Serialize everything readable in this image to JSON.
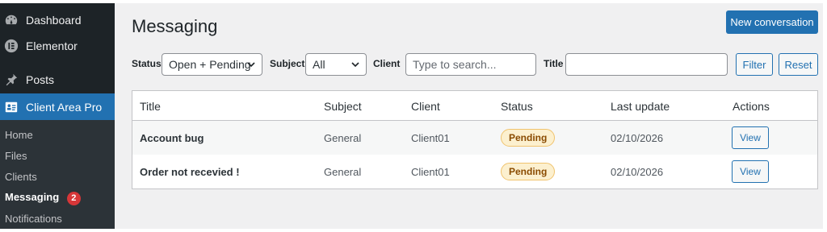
{
  "sidebar": {
    "items": [
      {
        "label": "Dashboard",
        "icon": "dashboard-icon"
      },
      {
        "label": "Elementor",
        "icon": "elementor-icon"
      },
      {
        "label": "Posts",
        "icon": "pushpin-icon"
      },
      {
        "label": "Client Area Pro",
        "icon": "id-card-icon",
        "active": true
      }
    ],
    "submenu": [
      {
        "label": "Home"
      },
      {
        "label": "Files"
      },
      {
        "label": "Clients"
      },
      {
        "label": "Messaging",
        "badge": "2",
        "current": true
      },
      {
        "label": "Notifications"
      }
    ]
  },
  "page": {
    "title": "Messaging",
    "new_button": "New conversation"
  },
  "filters": {
    "status_label": "Status",
    "status_value": "Open + Pending",
    "subject_label": "Subject",
    "subject_value": "All",
    "client_label": "Client",
    "client_placeholder": "Type to search...",
    "title_label": "Title",
    "title_value": "",
    "filter_button": "Filter",
    "reset_button": "Reset"
  },
  "table": {
    "columns": [
      "Title",
      "Subject",
      "Client",
      "Status",
      "Last update",
      "Actions"
    ],
    "rows": [
      {
        "title": "Account bug",
        "subject": "General",
        "client": "Client01",
        "status": "Pending",
        "last_update": "02/10/2026",
        "action": "View"
      },
      {
        "title": "Order not recevied !",
        "subject": "General",
        "client": "Client01",
        "status": "Pending",
        "last_update": "02/10/2026",
        "action": "View"
      }
    ]
  },
  "colors": {
    "sidebar_bg": "#1d2327",
    "accent": "#2271b1",
    "badge": "#d63638",
    "pending_bg": "#fcf0cf"
  }
}
